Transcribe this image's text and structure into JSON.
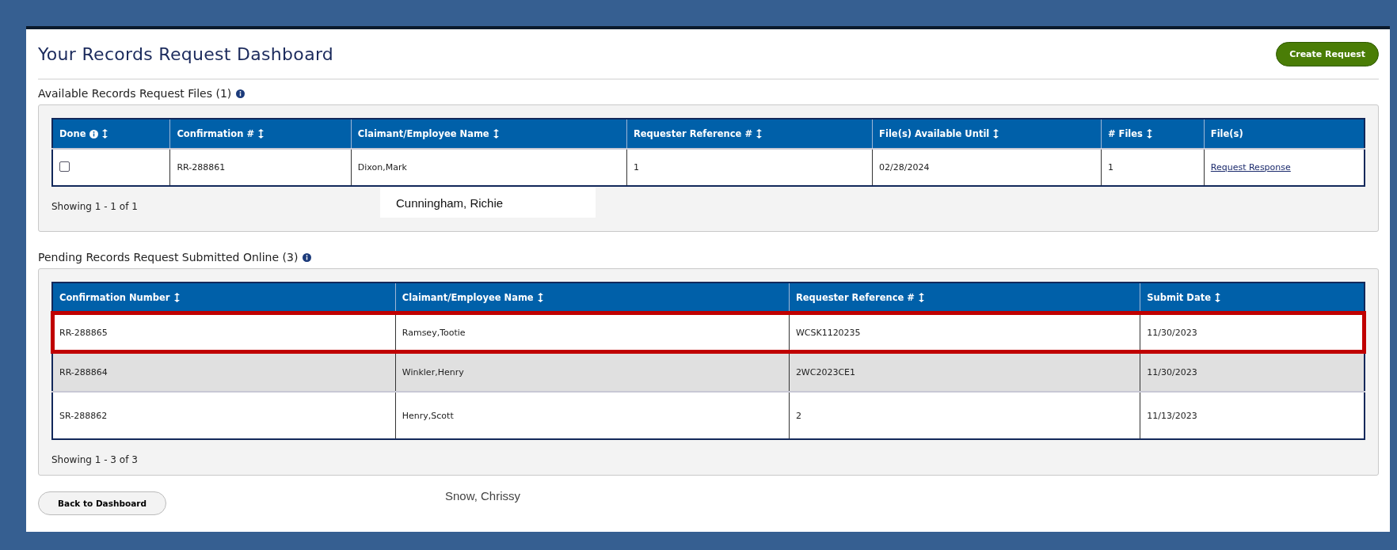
{
  "page": {
    "title": "Your Records Request Dashboard",
    "create_button": "Create Request"
  },
  "available": {
    "title": "Available Records Request Files (1)",
    "columns": [
      {
        "label": "Done",
        "info": true,
        "sortable": true
      },
      {
        "label": "Confirmation #",
        "info": false,
        "sortable": true
      },
      {
        "label": "Claimant/Employee Name",
        "info": false,
        "sortable": true
      },
      {
        "label": "Requester Reference #",
        "info": false,
        "sortable": true
      },
      {
        "label": "File(s) Available Until",
        "info": false,
        "sortable": true
      },
      {
        "label": "# Files",
        "info": false,
        "sortable": true
      },
      {
        "label": "File(s)",
        "info": false,
        "sortable": false
      }
    ],
    "rows": [
      {
        "cells": [
          {
            "kind": "checkbox",
            "checked": false
          },
          {
            "kind": "text",
            "text": "RR-288861"
          },
          {
            "kind": "text",
            "text": "Dixon,Mark"
          },
          {
            "kind": "text",
            "text": "1"
          },
          {
            "kind": "text",
            "text": "02/28/2024"
          },
          {
            "kind": "text",
            "text": "1"
          },
          {
            "kind": "link",
            "text": "Request Response"
          }
        ]
      }
    ],
    "footer": "Showing 1 - 1 of 1"
  },
  "overlay_label": "Cunningham, Richie",
  "pending": {
    "title": "Pending Records Request Submitted Online (3)",
    "columns": [
      {
        "label": "Confirmation Number",
        "sortable": true
      },
      {
        "label": "Claimant/Employee Name",
        "sortable": true
      },
      {
        "label": "Requester Reference #",
        "sortable": true
      },
      {
        "label": "Submit Date",
        "sortable": true
      }
    ],
    "rows": [
      {
        "highlighted": true,
        "cells": [
          "RR-288865",
          "Ramsey,Tootie",
          "WCSK1120235",
          "11/30/2023"
        ]
      },
      {
        "highlighted": false,
        "cells": [
          "RR-288864",
          "Winkler,Henry",
          "2WC2023CE1",
          "11/30/2023"
        ]
      },
      {
        "highlighted": false,
        "cells": [
          "SR-288862",
          "Henry,Scott",
          "2",
          "11/13/2023"
        ]
      }
    ],
    "footer": "Showing 1 - 3 of 3"
  },
  "back_button": "Back to Dashboard",
  "note": "Snow, Chrissy"
}
